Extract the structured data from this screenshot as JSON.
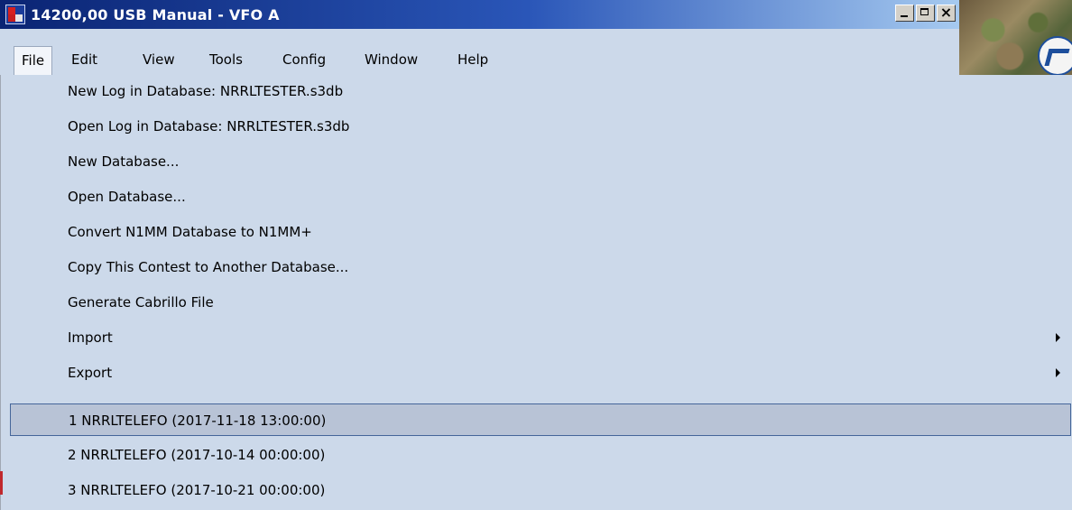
{
  "window": {
    "title": "14200,00 USB Manual - VFO A",
    "buttons": {
      "minimize": "_",
      "maximize": "□",
      "close": "×"
    }
  },
  "menubar": {
    "items": [
      {
        "label": "File",
        "open": true
      },
      {
        "label": "Edit"
      },
      {
        "label": "View"
      },
      {
        "label": "Tools"
      },
      {
        "label": "Config"
      },
      {
        "label": "Window"
      },
      {
        "label": "Help"
      }
    ]
  },
  "file_menu": {
    "items": [
      {
        "label": "New Log in Database: NRRLTESTER.s3db"
      },
      {
        "label": "Open Log in Database: NRRLTESTER.s3db"
      },
      {
        "label": "New Database..."
      },
      {
        "label": "Open Database..."
      },
      {
        "label": "Convert N1MM Database to N1MM+"
      },
      {
        "label": "Copy This Contest to Another Database..."
      },
      {
        "label": "Generate Cabrillo File"
      },
      {
        "label": "Import",
        "submenu": true
      },
      {
        "label": "Export",
        "submenu": true
      }
    ],
    "recent": [
      {
        "label": "1 NRRLTELEFO (2017-11-18 13:00:00)",
        "highlighted": true
      },
      {
        "label": "2 NRRLTELEFO (2017-10-14 00:00:00)"
      },
      {
        "label": "3 NRRLTELEFO (2017-10-21 00:00:00)"
      }
    ]
  },
  "icons": {
    "app": "n1mm-app-icon",
    "submenu": "submenu-arrow-icon"
  }
}
